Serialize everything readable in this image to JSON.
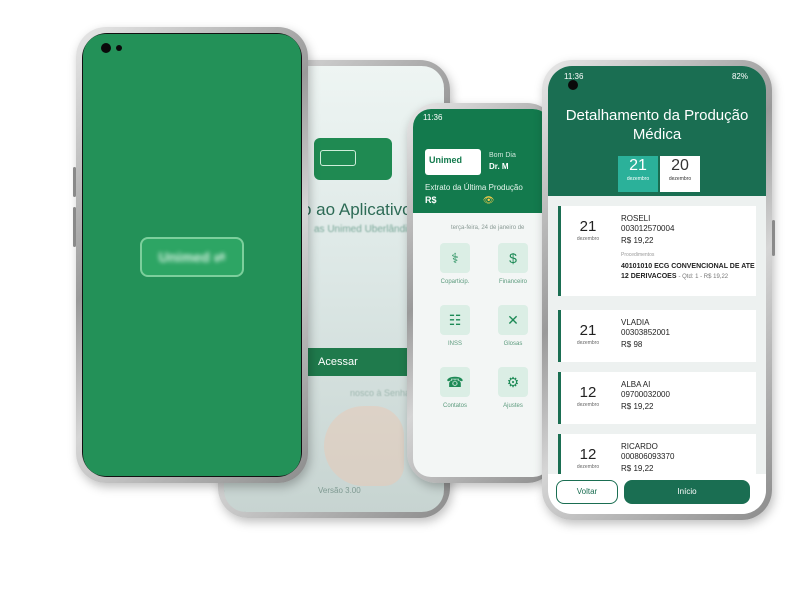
{
  "phone1": {
    "logo_text": "Unimed ⇌"
  },
  "phone2": {
    "welcome_text": "o ao Aplicativo",
    "sub_text": "as  Unimed Uberlândia",
    "access_button": "Acessar",
    "link_text": "nosco à Senha",
    "version": "Versão 3.00"
  },
  "phone3": {
    "status_time": "11:36",
    "logo_text": "Unimed",
    "greeting": "Bom Dia",
    "doctor": "Dr. M",
    "extract_label": "Extrato da Última Produção",
    "currency": "R$",
    "eye_icon": "👁",
    "date_line": "terça-feira, 24 de janeiro de",
    "tiles": [
      {
        "label": "Coparticip.",
        "icon": "⚕"
      },
      {
        "label": "Financeiro",
        "icon": "$"
      },
      {
        "label": "INSS",
        "icon": "☷"
      },
      {
        "label": "Glosas",
        "icon": "✕"
      },
      {
        "label": "Contatos",
        "icon": "☎"
      },
      {
        "label": "Ajustes",
        "icon": "⚙"
      }
    ]
  },
  "phone4": {
    "status_time": "11:36",
    "status_right": "82%",
    "title": "Detalhamento da Produção Médica",
    "chips": [
      {
        "day": "21",
        "month": "dezembro"
      },
      {
        "day": "20",
        "month": "dezembro"
      }
    ],
    "entries": [
      {
        "day": "21",
        "month": "dezembro",
        "name": "ROSELI",
        "code": "003012570004",
        "value": "R$ 19,22",
        "proc_label": "Procedimentos",
        "proc": "40101010 ECG CONVENCIONAL DE ATE 12 DERIVACOES",
        "proc_detail": "- Qtd: 1 - R$ 19,22"
      },
      {
        "day": "21",
        "month": "dezembro",
        "name": "VLADIA",
        "code": "00303852001",
        "value": "R$ 98"
      },
      {
        "day": "12",
        "month": "dezembro",
        "name": "ALBA AI",
        "code": "09700032000",
        "value": "R$ 19,22"
      },
      {
        "day": "12",
        "month": "dezembro",
        "name": "RICARDO",
        "code": "000806093370",
        "value": "R$ 19,22"
      }
    ],
    "back_button": "Voltar",
    "home_button": "Início"
  }
}
